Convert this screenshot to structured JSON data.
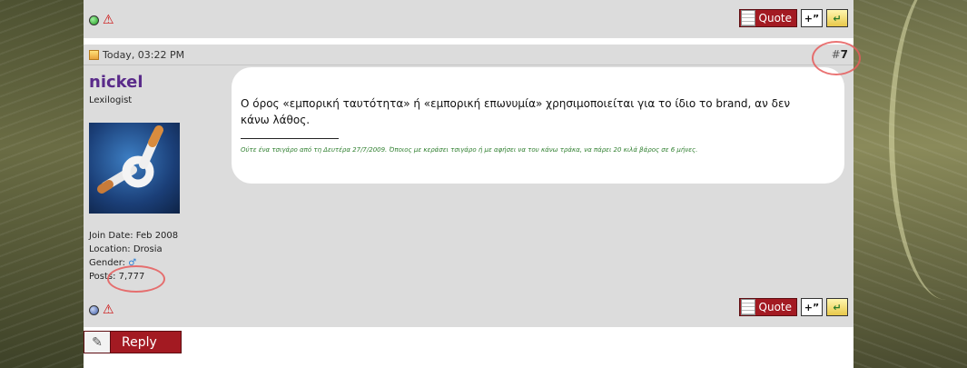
{
  "previous_post": {
    "buttons": {
      "quote_label": "Quote"
    }
  },
  "post": {
    "date": "Today, 03:22 PM",
    "number_prefix": "#",
    "number": "7",
    "user": {
      "name": "nickel",
      "title": "Lexilogist",
      "join_date": "Join Date: Feb 2008",
      "location": "Location: Drosia",
      "gender_label": "Gender:",
      "gender_symbol": "♂",
      "posts": "Posts: 7,777"
    },
    "message": "Ο όρος «εμπορική ταυτότητα» ή «εμπορική επωνυμία» χρησιμοποιείται για το ίδιο το brand, αν δεν κάνω λάθος.",
    "signature": "Ούτε ένα τσιγάρο από τη Δευτέρα 27/7/2009. Όποιος με κεράσει τσιγάρο ή με αφήσει να του κάνω τράκα, να πάρει 20 κιλά βάρος σε 6 μήνες.",
    "buttons": {
      "quote_label": "Quote"
    }
  },
  "reply_button": {
    "label": "Reply"
  },
  "icons": {
    "online": "online-status-icon",
    "offline": "offline-status-icon",
    "report": "report-warning-icon",
    "multiquote": "multiquote-icon",
    "report_post": "report-post-icon",
    "pencil": "pencil-icon"
  },
  "colors": {
    "username": "#5a2b8a",
    "signature": "#2f7f2f",
    "button_red": "#a31a22",
    "post_bg": "#dcdcdc"
  }
}
